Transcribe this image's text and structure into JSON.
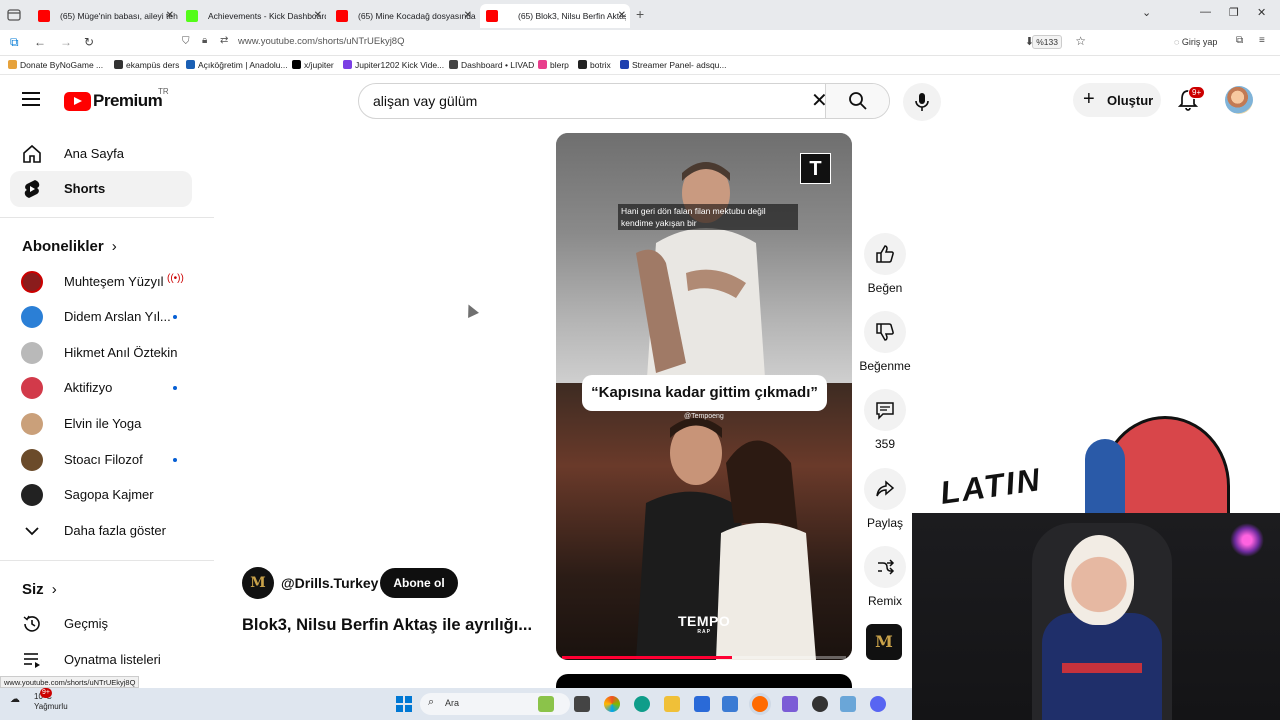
{
  "browser": {
    "tabs": [
      {
        "title": "(65) Müge'nin babası, aileyi tehdit",
        "favicon_color": "#ff0000"
      },
      {
        "title": "Achievements - Kick Dashboard",
        "favicon_color": "#53fc18"
      },
      {
        "title": "(65) Mine Kocadağ dosyasında",
        "favicon_color": "#ff0000"
      },
      {
        "title": "(65) Blok3, Nilsu Berfin Aktaş",
        "favicon_color": "#ff0000"
      }
    ],
    "url": "www.youtube.com/shorts/uNTrUEkyj8Q",
    "zoom": "%133",
    "signin_label": "Giriş yap",
    "bookmarks": [
      "Donate ByNoGame",
      "...",
      "ekampüs ders",
      "Açıköğretim | Anadolu...",
      "x/jupiter",
      "Jupiter1202 Kick Vide...",
      "Dashboard • LIVAD",
      "blerp",
      "botrix",
      "Streamer Panel- adsqu..."
    ],
    "status_url": "www.youtube.com/shorts/uNTrUEkyj8Q"
  },
  "youtube": {
    "logo_text": "Premium",
    "country_code": "TR",
    "search_query": "alişan vay gülüm",
    "create_label": "Oluştur",
    "notification_count": "9+"
  },
  "sidebar": {
    "main": [
      {
        "label": "Ana Sayfa",
        "icon": "home-icon"
      },
      {
        "label": "Shorts",
        "icon": "shorts-icon",
        "selected": true
      }
    ],
    "subscriptions_title": "Abonelikler",
    "subscriptions": [
      {
        "label": "Muhteşem Yüzyıl",
        "color": "#8a1c1c",
        "live": true
      },
      {
        "label": "Didem Arslan Yıl...",
        "color": "#2b7fd6",
        "new": true
      },
      {
        "label": "Hikmet Anıl Öztekin",
        "color": "#b9b9b9"
      },
      {
        "label": "Aktifizyo",
        "color": "#d23a4a",
        "new": true
      },
      {
        "label": "Elvin ile Yoga",
        "color": "#caa07a"
      },
      {
        "label": "Stoacı Filozof",
        "color": "#6b4b2a",
        "new": true
      },
      {
        "label": "Sagopa Kajmer",
        "color": "#222222"
      }
    ],
    "show_more_label": "Daha fazla göster",
    "you_title": "Siz",
    "you_items": [
      {
        "label": "Geçmiş",
        "icon": "history-icon"
      },
      {
        "label": "Oynatma listeleri",
        "icon": "playlists-icon"
      }
    ]
  },
  "short": {
    "caption": "Hani geri dön falan filan mektubu değil kendime yakışan bir",
    "quote": "“Kapısına kadar gittim çıkmadı”",
    "overlay_handle": "@Tempoeng",
    "brand": "TEMPO",
    "brand_sub": "RAP",
    "corner_logo": "T",
    "progress": 0.6,
    "channel_handle": "@Drills.Turkey",
    "channel_monogram": "M",
    "subscribe_label": "Abone ol",
    "title": "Blok3, Nilsu Berfin Aktaş ile ayrılığı..."
  },
  "actions": {
    "like_label": "Beğen",
    "dislike_label": "Beğenme",
    "comments_count": "359",
    "share_label": "Paylaş",
    "remix_label": "Remix"
  },
  "stream_overlay": {
    "art_text": "LATIN"
  },
  "taskbar": {
    "temperature": "10°C",
    "weather": "Yağmurlu",
    "weather_badge": "9+",
    "search_label": "Ara"
  }
}
